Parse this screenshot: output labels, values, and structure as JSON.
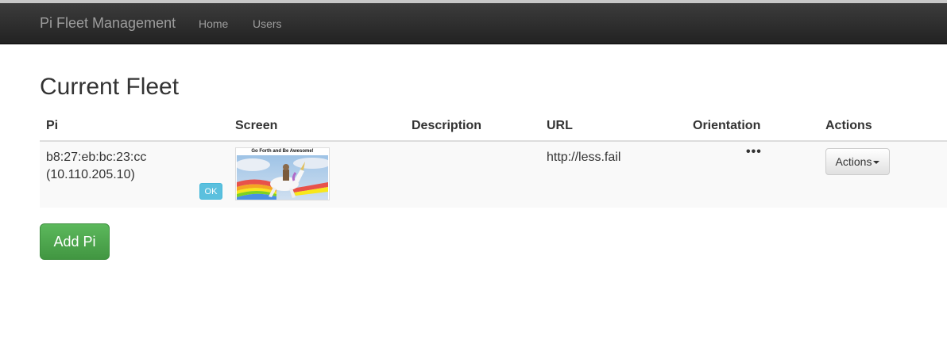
{
  "navbar": {
    "brand": "Pi Fleet Management",
    "links": [
      "Home",
      "Users"
    ]
  },
  "page": {
    "title": "Current Fleet"
  },
  "table": {
    "headers": [
      "Pi",
      "Screen",
      "Description",
      "URL",
      "Orientation",
      "Actions"
    ],
    "rows": [
      {
        "pi_mac": "b8:27:eb:bc:23:cc",
        "pi_ip": "(10.110.205.10)",
        "status": "OK",
        "screen_caption": "Go Forth and Be Awesome!",
        "description": "",
        "url": "http://less.fail",
        "orientation": "•••",
        "actions_label": "Actions"
      }
    ]
  },
  "add_button": {
    "label": "Add Pi"
  },
  "colors": {
    "navbar": "#222222",
    "ok_badge": "#5bc0de",
    "add_button": "#5cb85c",
    "row_stripe": "#f9f9f9"
  }
}
